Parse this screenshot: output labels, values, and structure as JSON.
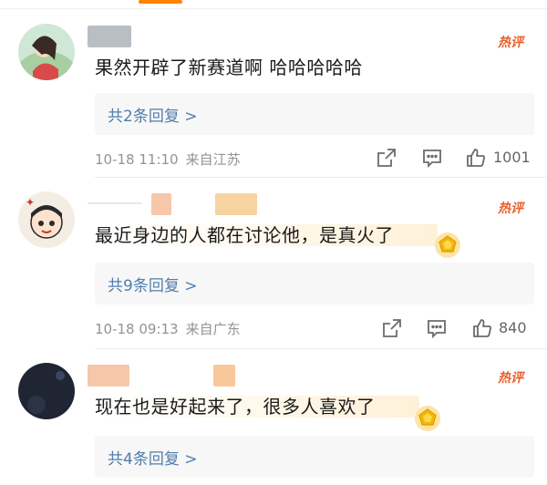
{
  "comments": [
    {
      "text": "果然开辟了新赛道啊 哈哈哈哈哈",
      "hot_label": "热评",
      "replies_label": "共2条回复 >",
      "date": "10-18 11:10",
      "source": "来自江苏",
      "likes": "1001",
      "has_badge": false
    },
    {
      "text": "最近身边的人都在讨论他，是真火了",
      "hot_label": "热评",
      "replies_label": "共9条回复 >",
      "date": "10-18 09:13",
      "source": "来自广东",
      "likes": "840",
      "has_badge": true
    },
    {
      "text": "现在也是好起来了，很多人喜欢了",
      "hot_label": "热评",
      "replies_label": "共4条回复 >",
      "has_badge": true
    }
  ],
  "icons": {
    "share": "share-icon",
    "comment": "comment-icon",
    "like": "thumb-up-icon",
    "badge": "gold-badge-icon"
  },
  "colors": {
    "accent": "#ff8200",
    "link": "#507daf",
    "hot": "#e8602c",
    "meta": "#939393"
  }
}
